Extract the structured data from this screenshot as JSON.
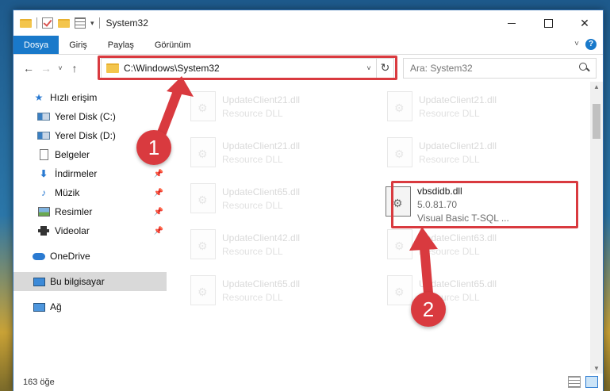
{
  "window": {
    "title": "System32",
    "quick_access": [
      "folder-icon",
      "properties-check-icon",
      "new-folder-icon",
      "properties-icon"
    ]
  },
  "ribbon": {
    "tabs": [
      "Dosya",
      "Giriş",
      "Paylaş",
      "Görünüm"
    ],
    "active_tab": "Dosya"
  },
  "nav": {
    "back": "←",
    "forward": "→",
    "recent": "˅",
    "up": "↑",
    "address": "C:\\Windows\\System32",
    "refresh": "↻",
    "search_placeholder": "Ara: System32"
  },
  "sidebar": {
    "items": [
      {
        "label": "Hızlı erişim",
        "icon": "star-icon"
      },
      {
        "label": "Yerel Disk (C:)",
        "icon": "drive-icon"
      },
      {
        "label": "Yerel Disk (D:)",
        "icon": "drive-icon"
      },
      {
        "label": "Belgeler",
        "icon": "documents-icon"
      },
      {
        "label": "İndirmeler",
        "icon": "downloads-icon"
      },
      {
        "label": "Müzik",
        "icon": "music-icon"
      },
      {
        "label": "Resimler",
        "icon": "pictures-icon"
      },
      {
        "label": "Videolar",
        "icon": "videos-icon"
      },
      {
        "label": "OneDrive",
        "icon": "onedrive-icon"
      },
      {
        "label": "Bu bilgisayar",
        "icon": "this-pc-icon"
      },
      {
        "label": "Ağ",
        "icon": "network-icon"
      }
    ],
    "selected": "Bu bilgisayar"
  },
  "files": [
    {
      "name": "UpdateClient21.dll",
      "desc": "Resource DLL"
    },
    {
      "name": "UpdateClient21.dll",
      "desc": "Resource DLL"
    },
    {
      "name": "UpdateClient21.dll",
      "desc": "Resource DLL"
    },
    {
      "name": "UpdateClient21.dll",
      "desc": "Resource DLL"
    },
    {
      "name": "UpdateClient65.dll",
      "desc": "Resource DLL"
    },
    {
      "name": "UpdateClient42.dll",
      "desc": "Resource DLL"
    },
    {
      "name": "UpdateClient63.dll",
      "desc": "Resource DLL"
    },
    {
      "name": "UpdateClient65.dll",
      "desc": "Resource DLL"
    },
    {
      "name": "UpdateClient65.dll",
      "desc": "Resource DLL"
    }
  ],
  "highlighted_file": {
    "name": "vbsdidb.dll",
    "version": "5.0.81.70",
    "desc": "Visual Basic T-SQL ..."
  },
  "status": {
    "count": "163 öğe"
  },
  "annotations": {
    "step1": "1",
    "step2": "2",
    "color": "#d93a3f"
  }
}
